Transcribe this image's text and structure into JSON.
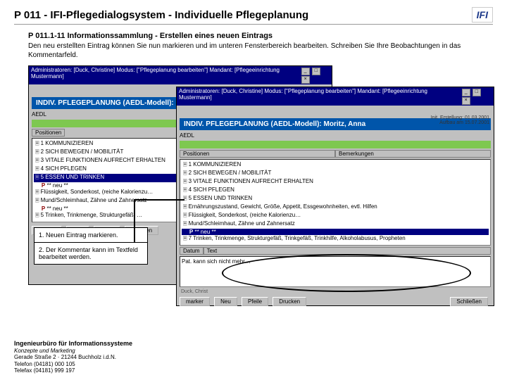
{
  "header": {
    "title": "P 011 - IFI-Pflegedialogsystem - Individuelle Pflegeplanung",
    "logo": "IFI"
  },
  "section": {
    "subtitle": "P 011.1-11 Informationssammlung - Erstellen eines neuen Eintrags",
    "body": "Den neu erstellten Eintrag können Sie nun markieren und im unteren Fensterbereich bearbeiten. Schreiben Sie Ihre Beobachtungen in das Kommentarfeld."
  },
  "window": {
    "titlebar": "Administratoren: [Duck, Christine]  Modus: [\"Pflegeplanung bearbeiten\"]  Mandant: [Pflegeeinrichtung Mustermann]",
    "inner_title": "INDIV. PFLEGEPLANUNG (AEDL-Modell): Moritz, Anna",
    "menu": "AEDL",
    "info1": "Init. Erstellung: 01.03.2001",
    "info2": "Aufbau am 15.07.2001",
    "colA": "Positionen",
    "colB": "Bemerkungen",
    "list": [
      "1  KOMMUNIZIEREN",
      "2  SICH BEWEGEN / MOBILITÄT",
      "3  VITALE FUNKTIONEN AUFRECHT ERHALTEN",
      "4  SICH PFLEGEN",
      "5  ESSEN UND TRINKEN"
    ],
    "new_item": "** neu **",
    "sub_items": [
      "Flüssigkeit, Sonderkost, (reiche Kalorienzu…",
      "Mund/Schleimhaut, Zähne und Zahnersatz",
      " ** neu **",
      "5  Trinken, Trinkmenge, Strukturgefäß, …"
    ],
    "sub_items2": [
      "Ernährungszustand, Gewicht, Größe, Appetit, Essgewohnheiten, evtl. Hilfen",
      "Flüssigkeit, Sonderkost, (reiche Kalorienzu…",
      "Mund/Schleimhaut, Zähne und Zahnersatz",
      " ** neu **",
      "7  Trinken, Trinkmenge, Strukturgefäß, Trinkgefäß, Trinkhilfe, Alkoholabusus, Propheten"
    ],
    "textcol1": "Datum",
    "textcol2": "Text",
    "text_entry": "Pat. kann sich nicht mehr…",
    "buttons": {
      "marker": "marker",
      "neu": "Neu",
      "pfeils": "Pfeile",
      "drucken": "Drucken",
      "schliessen": "Schließen"
    },
    "status": "Duck, Christ"
  },
  "callouts": {
    "c1": "1. Neuen Eintrag markieren.",
    "c2": "2. Der Kommentar kann im Textfeld bearbeitet werden."
  },
  "footer": {
    "title": "Ingenieurbüro für Informationssysteme",
    "sub": "Konzepte und Marketing",
    "addr": "Gerade Straße 2 · 21244 Buchholz i.d.N.",
    "tel": "Telefon (04181) 000 105",
    "fax": "Telefax (04181) 999 197"
  }
}
